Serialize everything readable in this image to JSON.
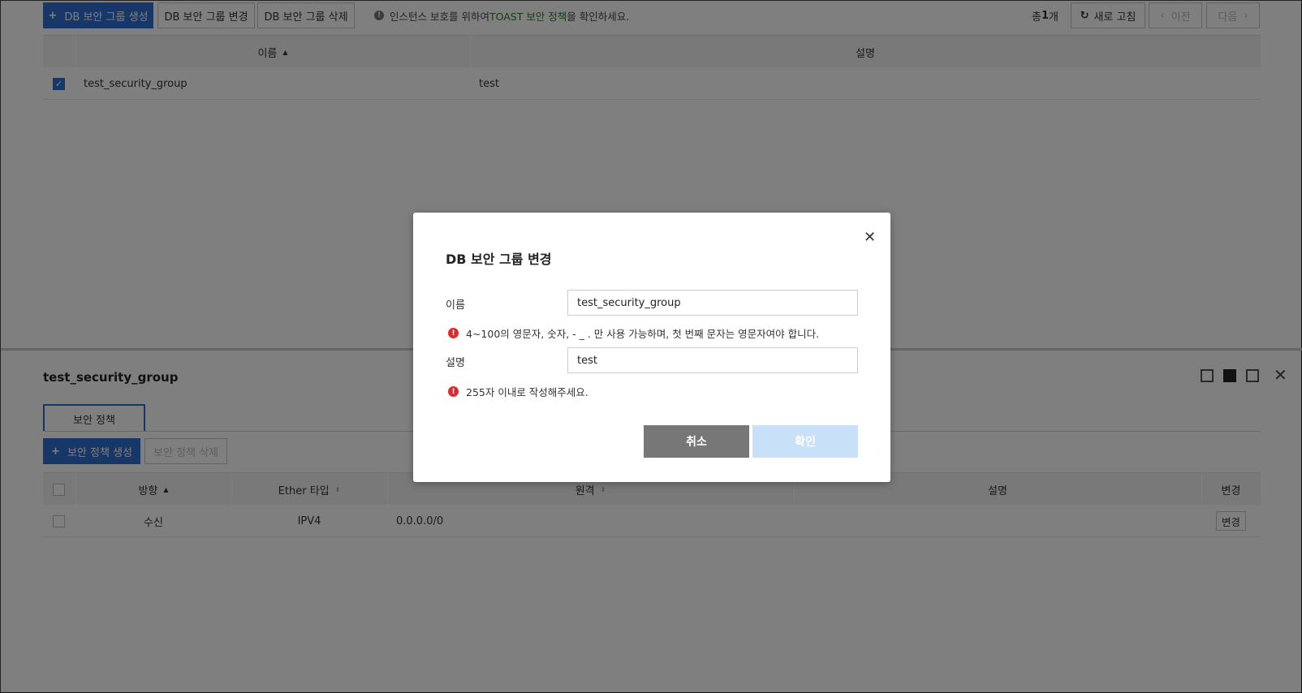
{
  "toolbar": {
    "create_label": "DB 보안 그룹 생성",
    "modify_label": "DB 보안 그룹 변경",
    "delete_label": "DB 보안 그룹 삭제",
    "info_prefix": "인스턴스 보호를 위하여",
    "info_link": "TOAST 보안 정책",
    "info_suffix": "을 확인하세요.",
    "total_prefix": "총",
    "total_count": "1",
    "total_suffix": "개",
    "refresh_label": "새로 고침",
    "prev_label": "이전",
    "next_label": "다음"
  },
  "group_table": {
    "columns": [
      "이름",
      "설명"
    ],
    "rows": [
      {
        "name": "test_security_group",
        "description": "test",
        "checked": true
      }
    ]
  },
  "detail": {
    "title": "test_security_group",
    "tab_label": "보안 정책",
    "create_policy_label": "보안 정책 생성",
    "delete_policy_label": "보안 정책 삭제",
    "columns": [
      "방향",
      "Ether 타입",
      "원격",
      "설명",
      "변경"
    ],
    "rows": [
      {
        "direction": "수신",
        "ether_type": "IPV4",
        "remote": "0.0.0.0/0",
        "description": "",
        "modify_label": "변경"
      }
    ]
  },
  "modal": {
    "title": "DB 보안 그룹 변경",
    "name_label": "이름",
    "name_value": "test_security_group",
    "name_hint": "4~100의 영문자, 숫자, - _ . 만 사용 가능하며, 첫 번째 문자는 영문자여야 합니다.",
    "desc_label": "설명",
    "desc_value": "test",
    "desc_hint": "255자 이내로 작성해주세요.",
    "cancel_label": "취소",
    "confirm_label": "확인"
  },
  "colors": {
    "primary": "#2f6fd1",
    "link": "#2f7a2a",
    "error": "#e0292e",
    "overlay": "rgba(0,0,0,0.5)"
  }
}
